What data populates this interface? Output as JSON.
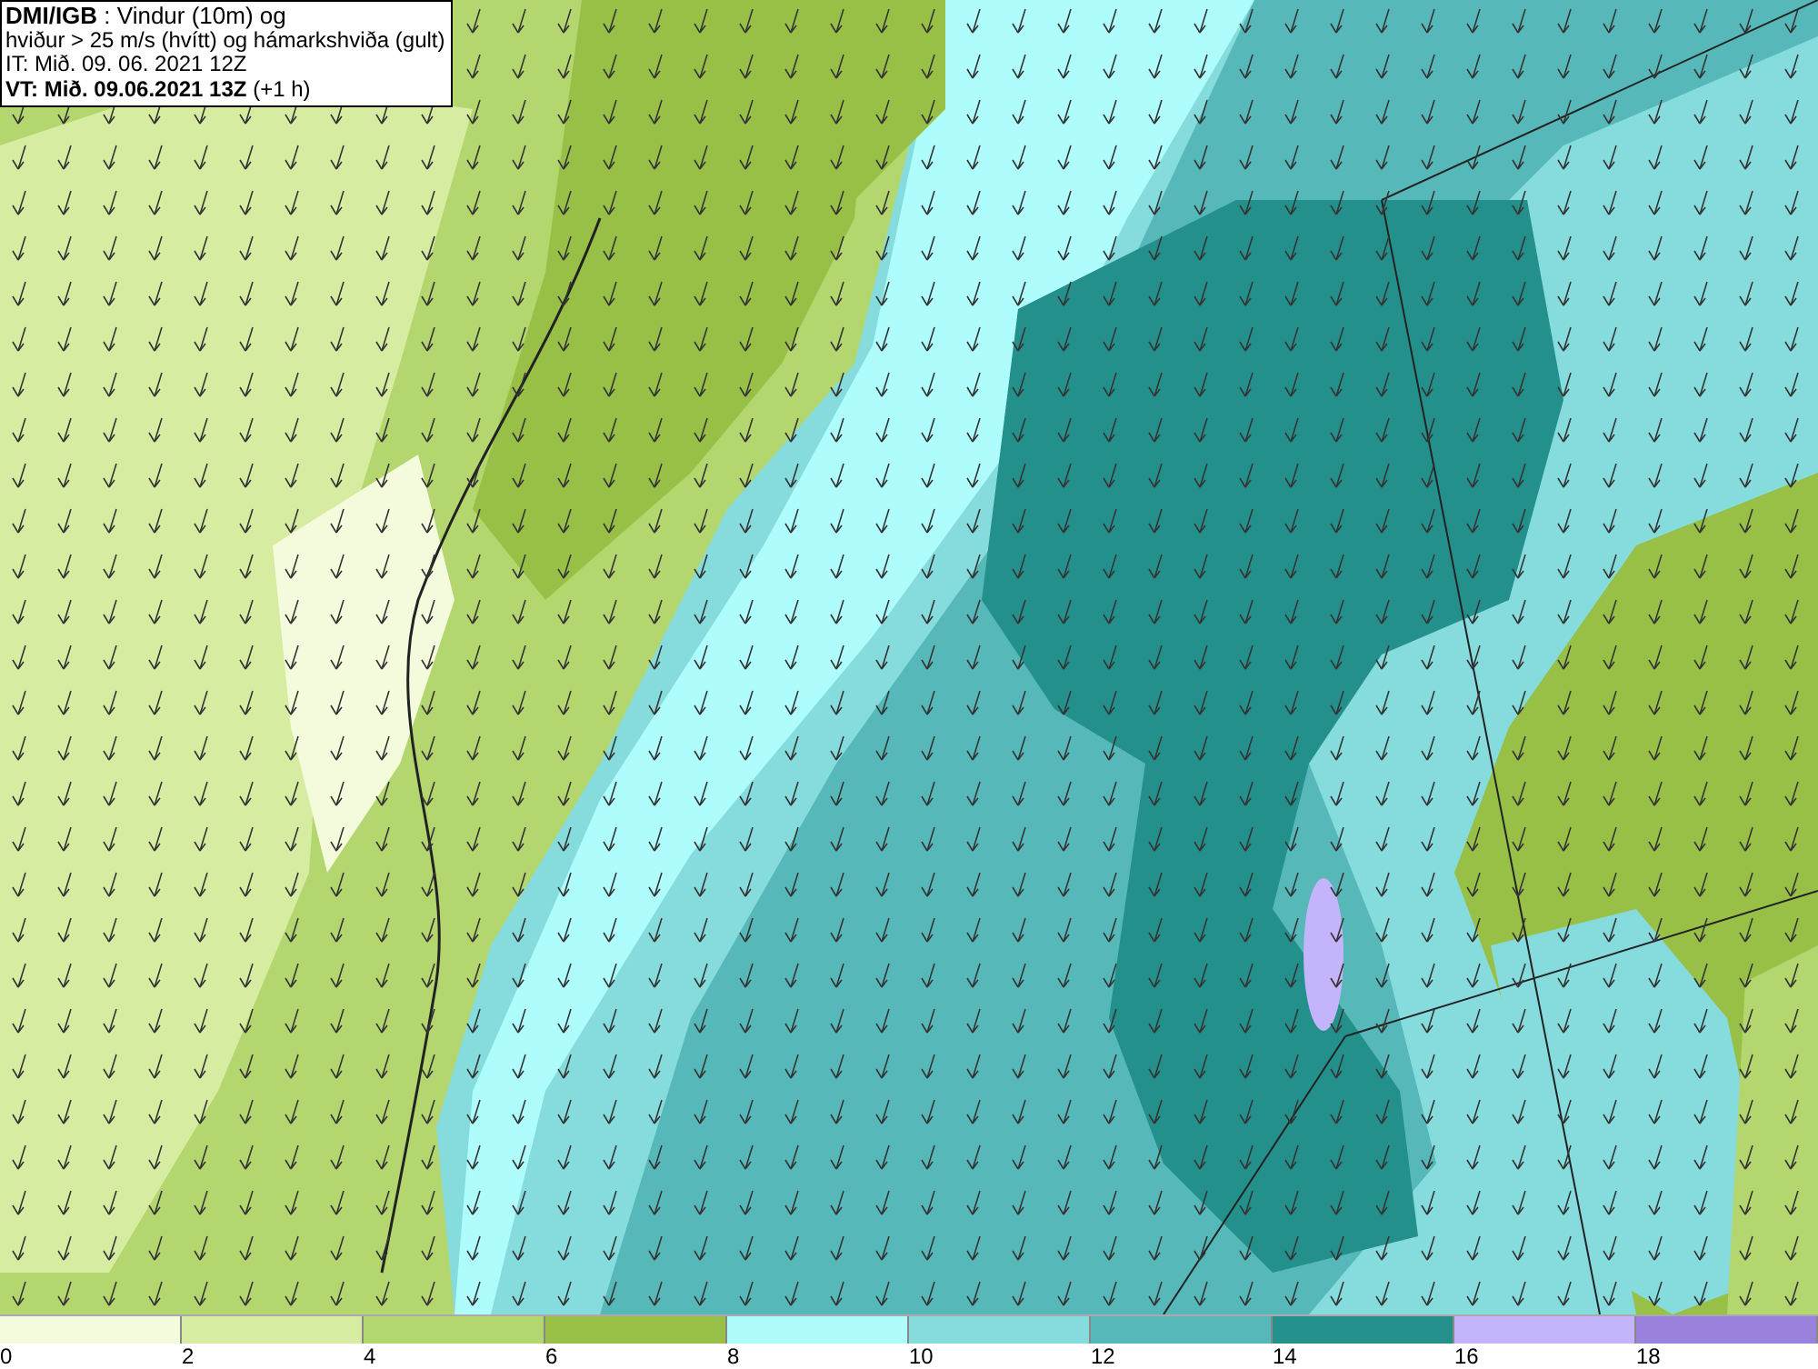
{
  "title_box": {
    "lines": [
      "**DMI/IGB** : Vindur (10m) og",
      "hviður > 25 m/s (hvítt) og hámarkshviða (gult)",
      "IT: Mið. 09. 06. 2021 12Z",
      "**VT: Mið. 09.06.2021 13Z** (+1 h)"
    ]
  },
  "legend": [
    {
      "label": "0",
      "color": "#f4fadc"
    },
    {
      "label": "2",
      "color": "#d6eca0"
    },
    {
      "label": "4",
      "color": "#b4d66e"
    },
    {
      "label": "6",
      "color": "#98c046"
    },
    {
      "label": "8",
      "color": "#aefcfc"
    },
    {
      "label": "10",
      "color": "#86dcdc"
    },
    {
      "label": "12",
      "color": "#56b8b8"
    },
    {
      "label": "14",
      "color": "#24908c"
    },
    {
      "label": "16",
      "color": "#c4b4fc"
    },
    {
      "label": "18",
      "color": "#9a82dc"
    }
  ]
}
